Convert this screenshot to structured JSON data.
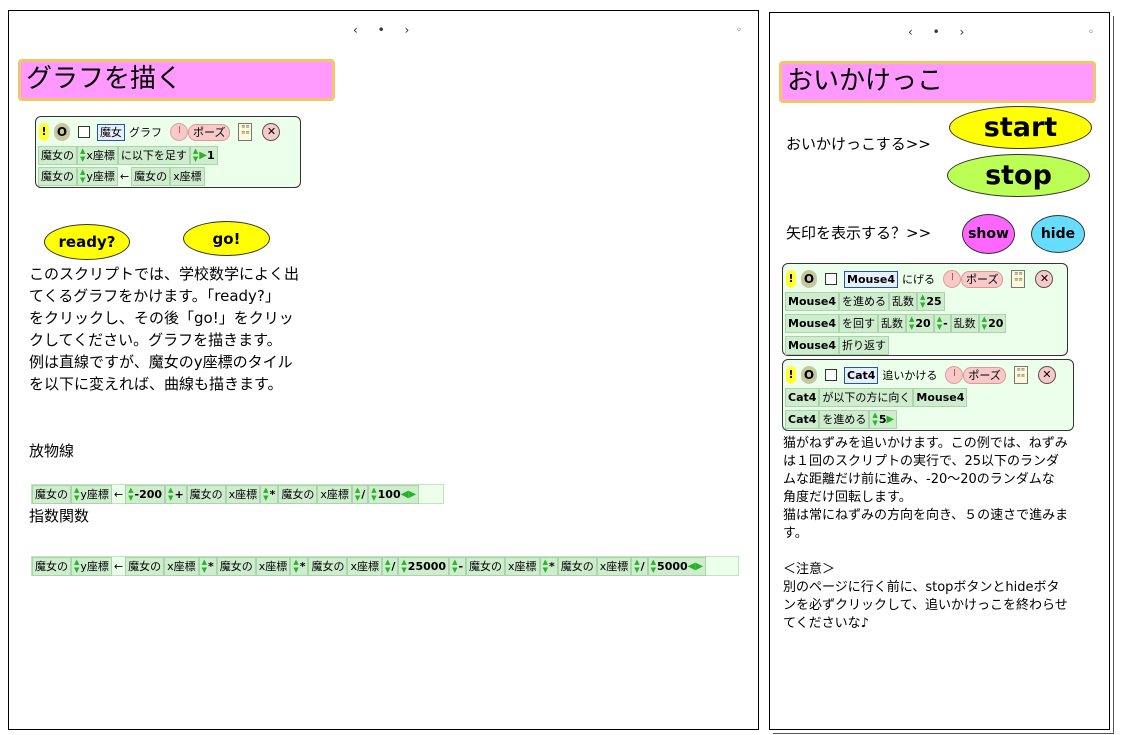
{
  "left": {
    "pager": "‹ • ›",
    "corner": "◦",
    "title": "グラフを描く",
    "script": {
      "bang": "!",
      "object": "魔女",
      "name": "グラフ",
      "pause": "ポーズ",
      "row1": {
        "obj": "魔女の",
        "attr": "x座標",
        "op": "に以下を足す",
        "val": "1"
      },
      "row2": {
        "obj": "魔女の",
        "attr": "y座標",
        "arrow": "←",
        "obj2": "魔女の",
        "attr2": "x座標"
      }
    },
    "ready_button": "ready?",
    "go_button": "go!",
    "description": [
      "このスクリプトでは、学校数学によく出",
      "てくるグラフをかけます。「ready?」",
      "をクリックし、その後「go!」をクリッ",
      "クしてください。グラフを描きます。",
      "例は直線ですが、魔女のy座標のタイル",
      "を以下に変えれば、曲線も描きます。"
    ],
    "parabola_label": "放物線",
    "parabola": {
      "obj": "魔女の",
      "attr": "y座標",
      "arrow": "←",
      "n1": "-200",
      "plus": "+",
      "o2": "魔女の",
      "a2": "x座標",
      "mul": "*",
      "o3": "魔女の",
      "a3": "x座標",
      "div": "/",
      "n2": "100"
    },
    "exp_label": "指数関数",
    "exponential": {
      "obj": "魔女の",
      "attr": "y座標",
      "arrow": "←",
      "o2": "魔女の",
      "a2": "x座標",
      "mul1": "*",
      "o3": "魔女の",
      "a3": "x座標",
      "mul2": "*",
      "o4": "魔女の",
      "a4": "x座標",
      "div1": "/",
      "n1": "25000",
      "minus": "-",
      "o5": "魔女の",
      "a5": "x座標",
      "mul3": "*",
      "o6": "魔女の",
      "a6": "x座標",
      "div2": "/",
      "n2": "5000"
    }
  },
  "right": {
    "pager": "‹ • ›",
    "corner": "◦",
    "title": "おいかけっこ",
    "chase_label": "おいかけっこする>>",
    "start_button": "start",
    "stop_button": "stop",
    "arrow_label": "矢印を表示する？>>",
    "show_button": "show",
    "hide_button": "hide",
    "mouse_script": {
      "bang": "!",
      "object": "Mouse4",
      "name": "にげる",
      "pause": "ポーズ",
      "row1": {
        "obj": "Mouse4",
        "op": "を進める",
        "rand": "乱数",
        "val": "25"
      },
      "row2": {
        "obj": "Mouse4",
        "op": "を回す",
        "rand1": "乱数",
        "val1": "20",
        "minus": "-",
        "rand2": "乱数",
        "val2": "20"
      },
      "row3": {
        "obj": "Mouse4",
        "op": "折り返す"
      }
    },
    "cat_script": {
      "bang": "!",
      "object": "Cat4",
      "name": "追いかける",
      "pause": "ポーズ",
      "row1": {
        "obj": "Cat4",
        "op": "が以下の方に向く",
        "target": "Mouse4"
      },
      "row2": {
        "obj": "Cat4",
        "op": "を進める",
        "val": "5"
      }
    },
    "description": [
      "猫がねずみを追いかけます。この例では、ねずみ",
      "は１回のスクリプトの実行で、25以下のランダ",
      "ムな距離だけ前に進み、-20～20のランダムな",
      "角度だけ回転します。",
      "猫は常にねずみの方向を向き、５の速さで進みま",
      "す。",
      "",
      "＜注意＞",
      "別のページに行く前に、stopボタンとhideボタ",
      "ンを必ずクリックして、追いかけっこを終わらせ",
      "てくださいな♪"
    ]
  },
  "colors": {
    "title_bg": "#ff99ff",
    "title_border": "#f2c46b",
    "script_bg": "#ebffeb",
    "tile_bg": "#cfeccf",
    "yellow_button": "#ffff00",
    "green_button": "#bbff55",
    "pink_button": "#ff66ff",
    "blue_button": "#66ddff"
  }
}
